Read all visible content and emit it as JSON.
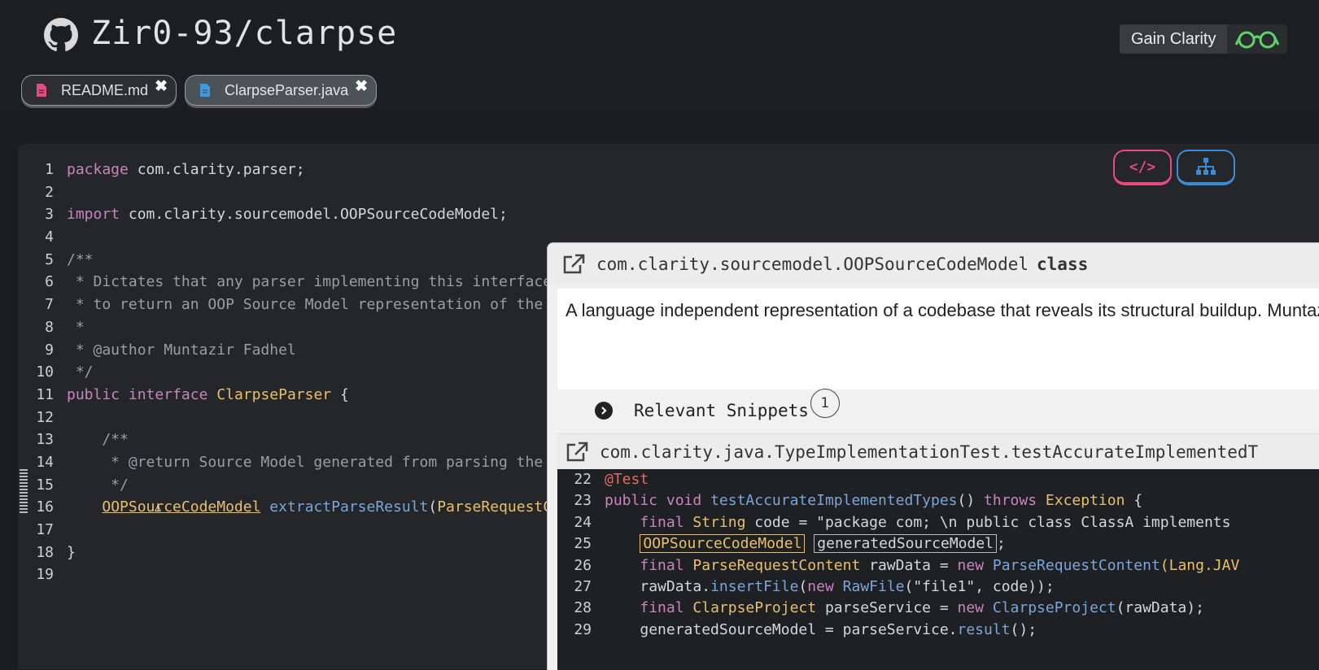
{
  "header": {
    "repo_title": "Zir0-93/clarpse",
    "gain_label": "Gain Clarity",
    "tabs": [
      {
        "label": "README.md",
        "icon_color": "#e84a7b"
      },
      {
        "label": "ClarpseParser.java",
        "icon_color": "#3d9be0"
      }
    ]
  },
  "editor": {
    "lines": [
      {
        "n": "1"
      },
      {
        "n": "2"
      },
      {
        "n": "3"
      },
      {
        "n": "4"
      },
      {
        "n": "5"
      },
      {
        "n": "6"
      },
      {
        "n": "7"
      },
      {
        "n": "8"
      },
      {
        "n": "9"
      },
      {
        "n": "10"
      },
      {
        "n": "11"
      },
      {
        "n": "12"
      },
      {
        "n": "13"
      },
      {
        "n": "14"
      },
      {
        "n": "15"
      },
      {
        "n": "16"
      },
      {
        "n": "17"
      },
      {
        "n": "18"
      },
      {
        "n": "19"
      }
    ],
    "code": {
      "l1_kw": "package",
      "l1_rest": " com.clarity.parser;",
      "l3_kw": "import",
      "l3_rest": " com.clarity.sourcemodel.OOPSourceCodeModel;",
      "l5": "/**",
      "l6": " * Dictates that any parser implementing this interface",
      "l7": " * to return an OOP Source Model representation of the p",
      "l8": " *",
      "l9": " * @author Muntazir Fadhel",
      "l10": " */",
      "l11_kw1": "public",
      "l11_kw2": "interface",
      "l11_type": "ClarpseParser",
      "l11_rest": " {",
      "l13": "    /**",
      "l14": "     * @return Source Model generated from parsing the p",
      "l15": "     */",
      "l16_type": "OOPSourceCodeModel",
      "l16_fn": "extractParseResult",
      "l16_paren": "(",
      "l16_arg": "ParseRequestCo",
      "l18": "}"
    }
  },
  "view_buttons": {
    "code": "</>",
    "tree": "tree-icon"
  },
  "tooltip": {
    "title_path": "com.clarity.sourcemodel.OOPSourceCodeModel",
    "title_kind": "class",
    "description": "A language independent representation of a codebase that reveals its structural buildup. Muntazir Fadhel",
    "snippets_label": "Relevant Snippets",
    "snippets_count": "1",
    "snippet_title": "com.clarity.java.TypeImplementationTest.testAccurateImplementedT",
    "snippet": {
      "l22_n": "22",
      "l22": "@Test",
      "l23_n": "23",
      "l23_kw": "public void",
      "l23_fn": "testAccurateImplementedTypes",
      "l23_mid": "() ",
      "l23_kw2": "throws",
      "l23_ty": "Exception",
      "l23_end": " {",
      "l24_n": "24",
      "l24_kw": "final",
      "l24_ty": "String",
      "l24_mid": " code = ",
      "l24_str": "\"package com; \\n public class ClassA implements",
      "l25_n": "25",
      "l25_ty": "OOPSourceCodeModel",
      "l25_var": "generatedSourceModel",
      "l25_end": ";",
      "l26_n": "26",
      "l26_kw": "final",
      "l26_ty": "ParseRequestContent",
      "l26_mid": " rawData = ",
      "l26_kw2": "new",
      "l26_ty2": "ParseRequestContent",
      "l26_end": "(Lang.JAV",
      "l27_n": "27",
      "l27_a": "rawData.",
      "l27_fn": "insertFile",
      "l27_b": "(",
      "l27_kw": "new",
      "l27_ty": "RawFile",
      "l27_str": "(\"file1\"",
      "l27_end": ", code));",
      "l28_n": "28",
      "l28_kw": "final",
      "l28_ty": "ClarpseProject",
      "l28_mid": " parseService = ",
      "l28_kw2": "new",
      "l28_ty2": "ClarpseProject",
      "l28_end": "(rawData);",
      "l29_n": "29",
      "l29_a": "generatedSourceModel = parseService.",
      "l29_fn": "result",
      "l29_end": "();"
    }
  }
}
